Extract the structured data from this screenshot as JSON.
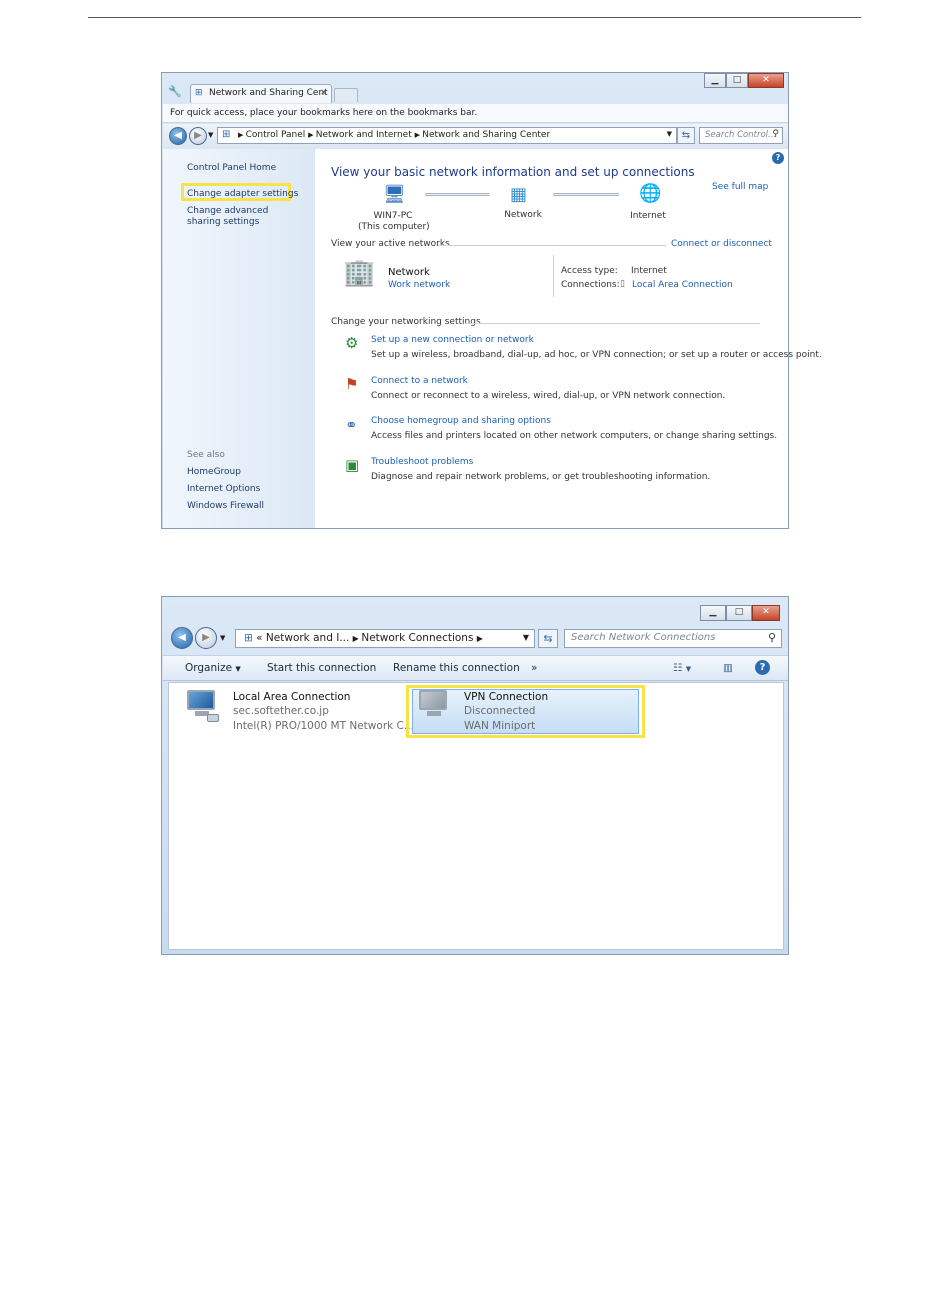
{
  "window1": {
    "tab_title": "Network and Sharing Cent",
    "bookmarks_bar_text": "For quick access, place your bookmarks here on the bookmarks bar.",
    "breadcrumb": [
      "Control Panel",
      "Network and Internet",
      "Network and Sharing Center"
    ],
    "search_placeholder": "Search Control...",
    "left_pane": {
      "home": "Control Panel Home",
      "change_adapter": "Change adapter settings",
      "change_sharing": "Change advanced sharing settings",
      "see_also_label": "See also",
      "see_also_items": [
        "HomeGroup",
        "Internet Options",
        "Windows Firewall"
      ]
    },
    "main": {
      "title": "View your basic network information and set up connections",
      "see_full_map": "See full map",
      "map_nodes": {
        "computer": "WIN7-PC",
        "computer_sub": "(This computer)",
        "network": "Network",
        "internet": "Internet"
      },
      "active_networks_label": "View your active networks",
      "connect_disconnect": "Connect or disconnect",
      "active_network_name": "Network",
      "active_network_type": "Work network",
      "access_type_label": "Access type:",
      "access_type_value": "Internet",
      "connections_label": "Connections:",
      "connections_value": "Local Area Connection",
      "change_settings_label": "Change your networking settings",
      "tasks": [
        {
          "link": "Set up a new connection or network",
          "desc": "Set up a wireless, broadband, dial-up, ad hoc, or VPN connection; or set up a router or access point."
        },
        {
          "link": "Connect to a network",
          "desc": "Connect or reconnect to a wireless, wired, dial-up, or VPN network connection."
        },
        {
          "link": "Choose homegroup and sharing options",
          "desc": "Access files and printers located on other network computers, or change sharing settings."
        },
        {
          "link": "Troubleshoot problems",
          "desc": "Diagnose and repair network problems, or get troubleshooting information."
        }
      ]
    }
  },
  "window2": {
    "breadcrumb_prefix": "«",
    "breadcrumb": [
      "Network and I...",
      "Network Connections"
    ],
    "search_placeholder": "Search Network Connections",
    "toolbar": {
      "organize": "Organize",
      "start": "Start this connection",
      "rename": "Rename this connection",
      "more": "»"
    },
    "items": [
      {
        "name": "Local Area Connection",
        "line2": "sec.softether.co.jp",
        "line3": "Intel(R) PRO/1000 MT Network C..."
      },
      {
        "name": "VPN Connection",
        "line2": "Disconnected",
        "line3": "WAN Miniport"
      }
    ]
  },
  "colors": {
    "highlight": "#f7e24a",
    "link": "#1a5fb4",
    "title_blue": "#1e3a8a"
  }
}
